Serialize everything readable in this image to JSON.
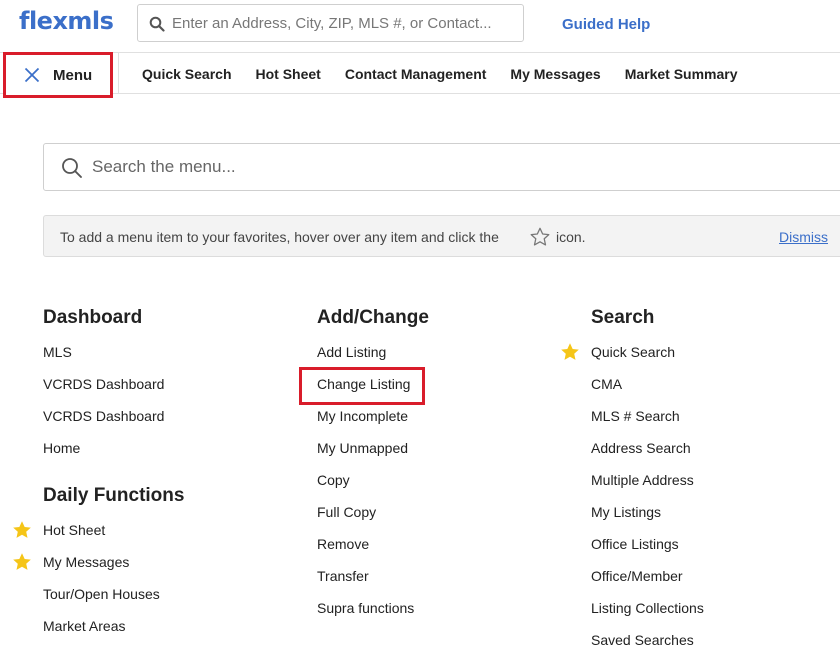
{
  "app": {
    "logo": "flexmls"
  },
  "header": {
    "search_placeholder": "Enter an Address, City, ZIP, MLS #, or Contact...",
    "guided_help": "Guided Help"
  },
  "nav": {
    "menu_label": "Menu",
    "links": [
      "Quick Search",
      "Hot Sheet",
      "Contact Management",
      "My Messages",
      "Market Summary"
    ]
  },
  "menu_search": {
    "placeholder": "Search the menu..."
  },
  "banner": {
    "text_before": "To add a menu item to your favorites, hover over any item and click the",
    "text_after": "icon.",
    "dismiss": "Dismiss"
  },
  "columns": {
    "dashboard": {
      "title": "Dashboard",
      "items": [
        "MLS",
        "VCRDS Dashboard",
        "VCRDS Dashboard",
        "Home"
      ]
    },
    "daily_functions": {
      "title": "Daily Functions",
      "items": [
        "Hot Sheet",
        "My Messages",
        "Tour/Open Houses",
        "Market Areas"
      ]
    },
    "add_change": {
      "title": "Add/Change",
      "items": [
        "Add Listing",
        "Change Listing",
        "My Incomplete",
        "My Unmapped",
        "Copy",
        "Full Copy",
        "Remove",
        "Transfer",
        "Supra functions"
      ]
    },
    "search": {
      "title": "Search",
      "items": [
        "Quick Search",
        "CMA",
        "MLS # Search",
        "Address Search",
        "Multiple Address",
        "My Listings",
        "Office Listings",
        "Office/Member",
        "Listing Collections",
        "Saved Searches"
      ]
    }
  },
  "colors": {
    "brand": "#3b6fc9",
    "highlight": "#d91c2a",
    "favorite_star": "#f5c518"
  }
}
